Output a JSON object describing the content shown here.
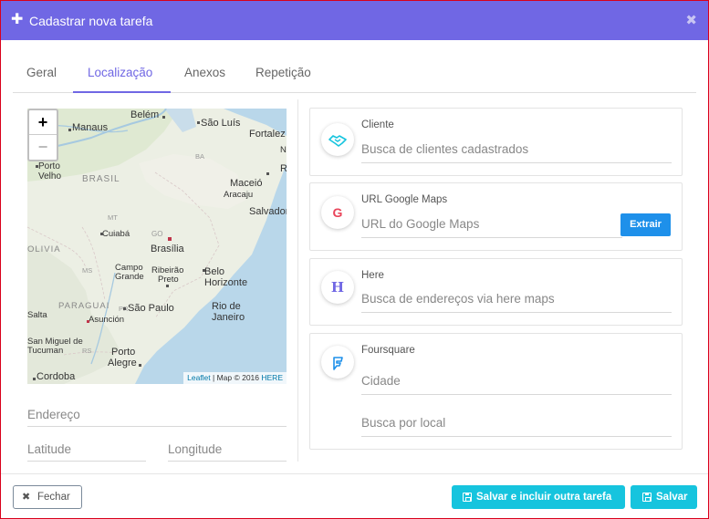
{
  "dialog": {
    "title": "Cadastrar nova tarefa",
    "plus_glyph": "✚",
    "close_glyph": "✖"
  },
  "tabs": [
    {
      "label": "Geral",
      "active": false
    },
    {
      "label": "Localização",
      "active": true
    },
    {
      "label": "Anexos",
      "active": false
    },
    {
      "label": "Repetição",
      "active": false
    }
  ],
  "map": {
    "zoom_in": "+",
    "zoom_out": "−",
    "attribution_leaflet": "Leaflet",
    "attribution_text": " | Map © 2016 ",
    "attribution_here": "HERE",
    "countries": [
      "BRASIL",
      "OLIVIA",
      "PARAGUAI"
    ],
    "cities": [
      "Belém",
      "Manaus",
      "São Luís",
      "Fortalez",
      "Porto",
      "Velho",
      "Maceió",
      "Aracaju",
      "Salvador",
      "Cuiabá",
      "Brasília",
      "GO",
      "Campo",
      "Grande",
      "Ribeirão",
      "Preto",
      "Belo",
      "Horizonte",
      "São Paulo",
      "Rio de",
      "Janeiro",
      "Asunción",
      "Salta",
      "San Miguel de",
      "Tucuman",
      "Porto",
      "Alegre",
      "Cordoba",
      "MT",
      "MS",
      "PR",
      "RS",
      "N",
      "R",
      "BA"
    ]
  },
  "location_fields": {
    "endereco": "Endereço",
    "latitude": "Latitude",
    "longitude": "Longitude"
  },
  "cards": {
    "cliente": {
      "label": "Cliente",
      "placeholder": "Busca de clientes cadastrados",
      "icon": "handshake-icon",
      "color": "#16c4de"
    },
    "google": {
      "label": "URL Google Maps",
      "placeholder": "URL do Google Maps",
      "button": "Extrair",
      "icon": "google-icon",
      "icon_glyph": "G",
      "color": "#e9445a"
    },
    "here": {
      "label": "Here",
      "placeholder": "Busca de endereços via here maps",
      "icon": "here-icon",
      "icon_glyph": "H",
      "color": "#7067e4"
    },
    "foursquare": {
      "label": "Foursquare",
      "placeholder_city": "Cidade",
      "placeholder_local": "Busca por local",
      "icon": "foursquare-icon",
      "color": "#1e90ea"
    }
  },
  "footer": {
    "close_label": "Fechar",
    "close_glyph": "✖",
    "save_and_new_label": "Salvar e incluir outra tarefa",
    "save_label": "Salvar"
  },
  "colors": {
    "accent": "#7067e4",
    "button": "#16c4de",
    "blue": "#1e90ea",
    "border_red": "#d9001b"
  }
}
